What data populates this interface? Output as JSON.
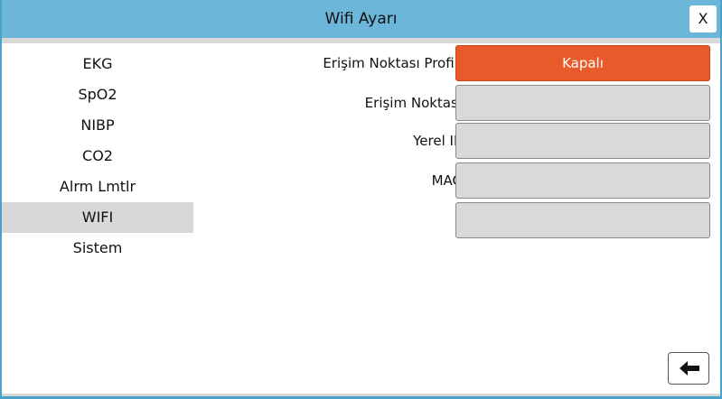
{
  "window": {
    "title": "Wifi Ayarı",
    "close_label": "X"
  },
  "sidebar": {
    "items": [
      {
        "label": "EKG"
      },
      {
        "label": "SpO2"
      },
      {
        "label": "NIBP"
      },
      {
        "label": "CO2"
      },
      {
        "label": "Alrm Lmtlr"
      },
      {
        "label": "WIFI",
        "active": true
      },
      {
        "label": "Sistem"
      }
    ]
  },
  "settings": {
    "access_point_profile": {
      "label": "Erişim Noktası Profili",
      "value": "Kapalı"
    },
    "access_point": {
      "label": "Erişim Noktası",
      "value": ""
    },
    "local_ip": {
      "label": "Yerel IP",
      "value": ""
    },
    "mac": {
      "label": "MAC",
      "value": ""
    },
    "extra": {
      "label": "",
      "value": ""
    }
  },
  "footer": {
    "back_icon": "arrow-left-icon"
  },
  "colors": {
    "titlebar": "#6cb6d9",
    "accent_orange": "#e85a2a",
    "field_gray": "#d9d9d9",
    "active_item": "#d8d8d8"
  }
}
